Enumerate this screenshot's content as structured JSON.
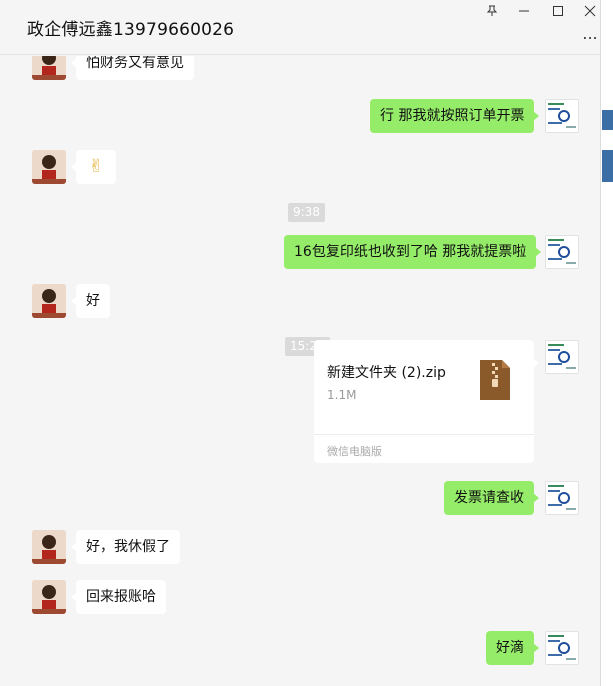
{
  "window": {
    "title": "政企傅远鑫13979660026",
    "pin_icon": "pin-icon",
    "minimize_icon": "minimize-icon",
    "maximize_icon": "maximize-icon",
    "close_icon": "close-icon",
    "more_label": "..."
  },
  "messages": {
    "m1": "怕财务又有意见",
    "m2": "行 那我就按照订单开票",
    "m3": "✌",
    "t1": "9:38",
    "m4": "16包复印纸也收到了哈 那我就提票啦",
    "m5": "好",
    "t2": "15:26",
    "file": {
      "name": "新建文件夹 (2).zip",
      "size": "1.1M",
      "source": "微信电脑版",
      "icon": "zip-file-icon"
    },
    "m6": "发票请查收",
    "m7": "好，我休假了",
    "m8": "回来报账哈",
    "m9": "好滴"
  },
  "colors": {
    "sent_bubble": "#95ec69",
    "received_bubble": "#ffffff",
    "background": "#f5f5f5",
    "timestamp_bg": "#dadada"
  }
}
